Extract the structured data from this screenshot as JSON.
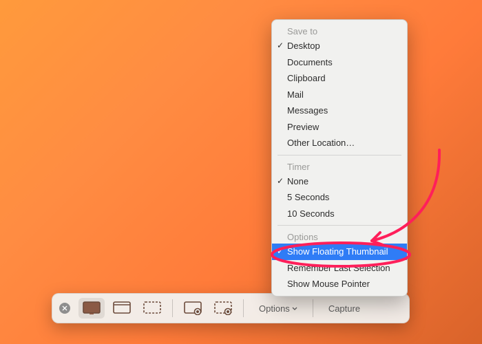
{
  "toolbar": {
    "options_label": "Options",
    "capture_label": "Capture"
  },
  "menu": {
    "sections": {
      "save_to": {
        "header": "Save to",
        "items": [
          {
            "label": "Desktop",
            "checked": true
          },
          {
            "label": "Documents",
            "checked": false
          },
          {
            "label": "Clipboard",
            "checked": false
          },
          {
            "label": "Mail",
            "checked": false
          },
          {
            "label": "Messages",
            "checked": false
          },
          {
            "label": "Preview",
            "checked": false
          },
          {
            "label": "Other Location…",
            "checked": false
          }
        ]
      },
      "timer": {
        "header": "Timer",
        "items": [
          {
            "label": "None",
            "checked": true
          },
          {
            "label": "5 Seconds",
            "checked": false
          },
          {
            "label": "10 Seconds",
            "checked": false
          }
        ]
      },
      "options": {
        "header": "Options",
        "items": [
          {
            "label": "Show Floating Thumbnail",
            "checked": true,
            "highlighted": true
          },
          {
            "label": "Remember Last Selection",
            "checked": false
          },
          {
            "label": "Show Mouse Pointer",
            "checked": false
          }
        ]
      }
    }
  },
  "annotation": {
    "color": "#ff1f5a",
    "target": "Show Floating Thumbnail"
  }
}
